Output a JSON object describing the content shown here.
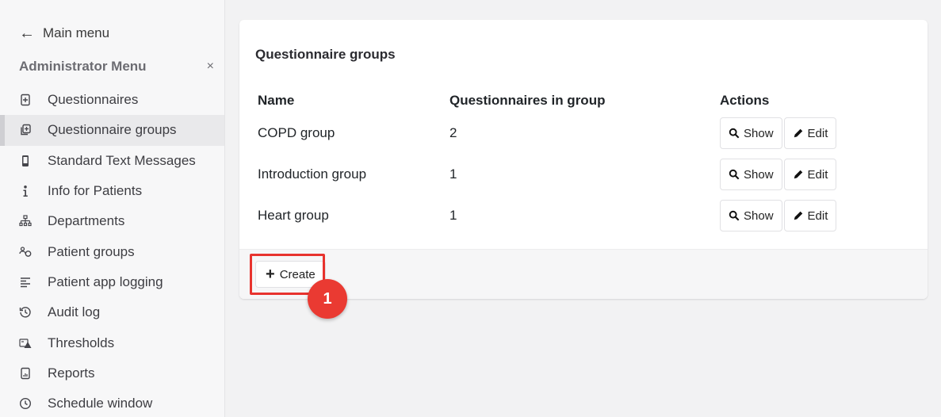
{
  "sidebar": {
    "back_label": "Main menu",
    "menu_title": "Administrator Menu",
    "close_symbol": "×",
    "items": [
      {
        "label": "Questionnaires",
        "icon": "questionnaire-icon"
      },
      {
        "label": "Questionnaire groups",
        "icon": "copy-group-icon",
        "active": true
      },
      {
        "label": "Standard Text Messages",
        "icon": "phone-icon"
      },
      {
        "label": "Info for Patients",
        "icon": "info-icon"
      },
      {
        "label": "Departments",
        "icon": "sitemap-icon"
      },
      {
        "label": "Patient groups",
        "icon": "users-icon"
      },
      {
        "label": "Patient app logging",
        "icon": "align-left-icon"
      },
      {
        "label": "Audit log",
        "icon": "history-icon"
      },
      {
        "label": "Thresholds",
        "icon": "threshold-icon"
      },
      {
        "label": "Reports",
        "icon": "report-icon"
      },
      {
        "label": "Schedule window",
        "icon": "clock-icon"
      }
    ]
  },
  "main": {
    "title": "Questionnaire groups",
    "columns": [
      "Name",
      "Questionnaires in group",
      "Actions"
    ],
    "rows": [
      {
        "name": "COPD group",
        "count": "2"
      },
      {
        "name": "Introduction group",
        "count": "1"
      },
      {
        "name": "Heart group",
        "count": "1"
      }
    ],
    "show_label": "Show",
    "edit_label": "Edit",
    "create_label": "Create"
  },
  "annotation": {
    "step_number": "1",
    "color": "#ea3a32"
  }
}
